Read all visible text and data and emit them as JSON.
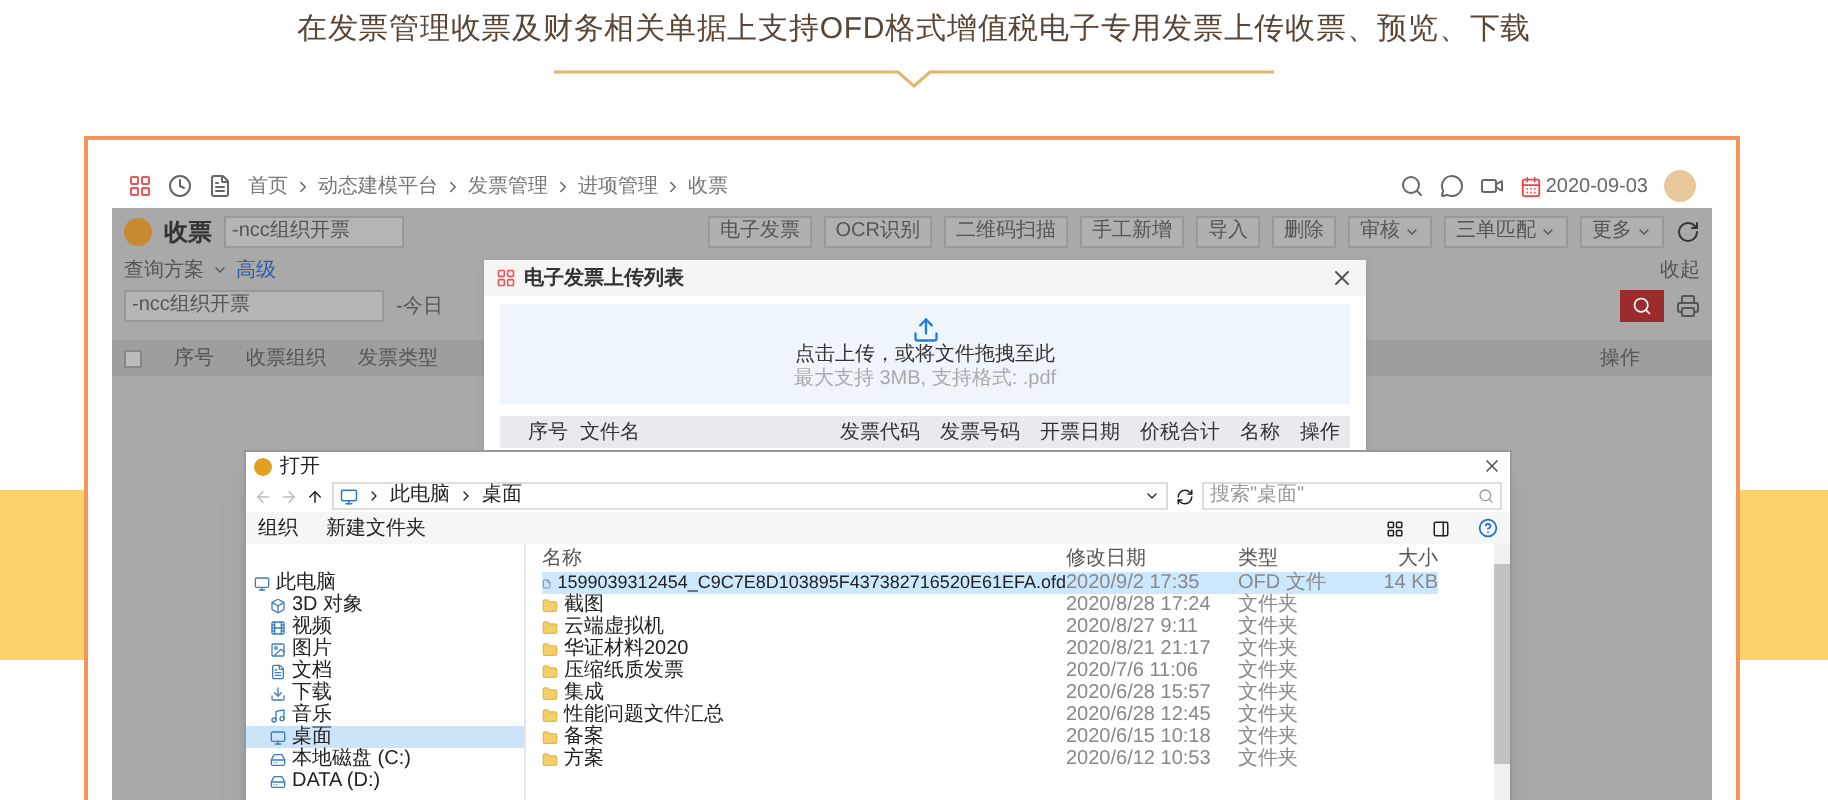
{
  "banner": {
    "title": "在发票管理收票及财务相关单据上支持OFD格式增值税电子专用发票上传收票、预览、下载"
  },
  "app": {
    "breadcrumb": [
      "首页",
      "动态建模平台",
      "发票管理",
      "进项管理",
      "收票"
    ],
    "date": "2020-09-03",
    "page_title": "收票",
    "org_field": "-ncc组织开票",
    "toolbar": [
      {
        "label": "电子发票",
        "dropdown": false
      },
      {
        "label": "OCR识别",
        "dropdown": false
      },
      {
        "label": "二维码扫描",
        "dropdown": false
      },
      {
        "label": "手工新增",
        "dropdown": false
      },
      {
        "label": "导入",
        "dropdown": false
      },
      {
        "label": "删除",
        "dropdown": false
      },
      {
        "label": "审核",
        "dropdown": true
      },
      {
        "label": "三单匹配",
        "dropdown": true
      },
      {
        "label": "更多",
        "dropdown": true
      }
    ],
    "filter": {
      "scheme": "查询方案",
      "advanced": "高级",
      "org_value": "-ncc组织开票",
      "date_value": "-今日",
      "collapse": "收起"
    },
    "table": {
      "select_all": false,
      "columns": [
        "序号",
        "收票组织",
        "发票类型"
      ],
      "action_column": "操作"
    }
  },
  "upload_dialog": {
    "title": "电子发票上传列表",
    "drop_text": "点击上传，或将文件拖拽至此",
    "hint": "最大支持 3MB, 支持格式: .pdf",
    "columns": [
      "序号",
      "文件名",
      "发票代码",
      "发票号码",
      "开票日期",
      "价税合计",
      "名称",
      "操作"
    ]
  },
  "open_dialog": {
    "title": "打开",
    "path": [
      "此电脑",
      "桌面"
    ],
    "search_placeholder": "搜索\"桌面\"",
    "organize": "组织",
    "new_folder": "新建文件夹",
    "nav": [
      {
        "label": "此电脑",
        "kind": "pc",
        "selected": false
      },
      {
        "label": "3D 对象",
        "kind": "cube",
        "selected": false
      },
      {
        "label": "视频",
        "kind": "video",
        "selected": false
      },
      {
        "label": "图片",
        "kind": "image",
        "selected": false
      },
      {
        "label": "文档",
        "kind": "doc",
        "selected": false
      },
      {
        "label": "下载",
        "kind": "download",
        "selected": false
      },
      {
        "label": "音乐",
        "kind": "music",
        "selected": false
      },
      {
        "label": "桌面",
        "kind": "desktop",
        "selected": true
      },
      {
        "label": "本地磁盘 (C:)",
        "kind": "drive",
        "selected": false
      },
      {
        "label": "DATA (D:)",
        "kind": "drive",
        "selected": false
      }
    ],
    "columns": [
      "名称",
      "修改日期",
      "类型",
      "大小"
    ],
    "files": [
      {
        "name": "1599039312454_C9C7E8D103895F437382716520E61EFA.ofd",
        "date": "2020/9/2 17:35",
        "type": "OFD 文件",
        "size": "14 KB",
        "kind": "file",
        "selected": true
      },
      {
        "name": "截图",
        "date": "2020/8/28 17:24",
        "type": "文件夹",
        "kind": "folder",
        "selected": false
      },
      {
        "name": "云端虚拟机",
        "date": "2020/8/27 9:11",
        "type": "文件夹",
        "kind": "folder",
        "selected": false
      },
      {
        "name": "华证材料2020",
        "date": "2020/8/21 21:17",
        "type": "文件夹",
        "kind": "folder",
        "selected": false
      },
      {
        "name": "压缩纸质发票",
        "date": "2020/7/6 11:06",
        "type": "文件夹",
        "kind": "folder",
        "selected": false
      },
      {
        "name": "集成",
        "date": "2020/6/28 15:57",
        "type": "文件夹",
        "kind": "folder",
        "selected": false
      },
      {
        "name": "性能问题文件汇总",
        "date": "2020/6/28 12:45",
        "type": "文件夹",
        "kind": "folder",
        "selected": false
      },
      {
        "name": "备案",
        "date": "2020/6/15 10:18",
        "type": "文件夹",
        "kind": "folder",
        "selected": false
      },
      {
        "name": "方案",
        "date": "2020/6/12 10:53",
        "type": "文件夹",
        "kind": "folder",
        "selected": false
      }
    ]
  }
}
